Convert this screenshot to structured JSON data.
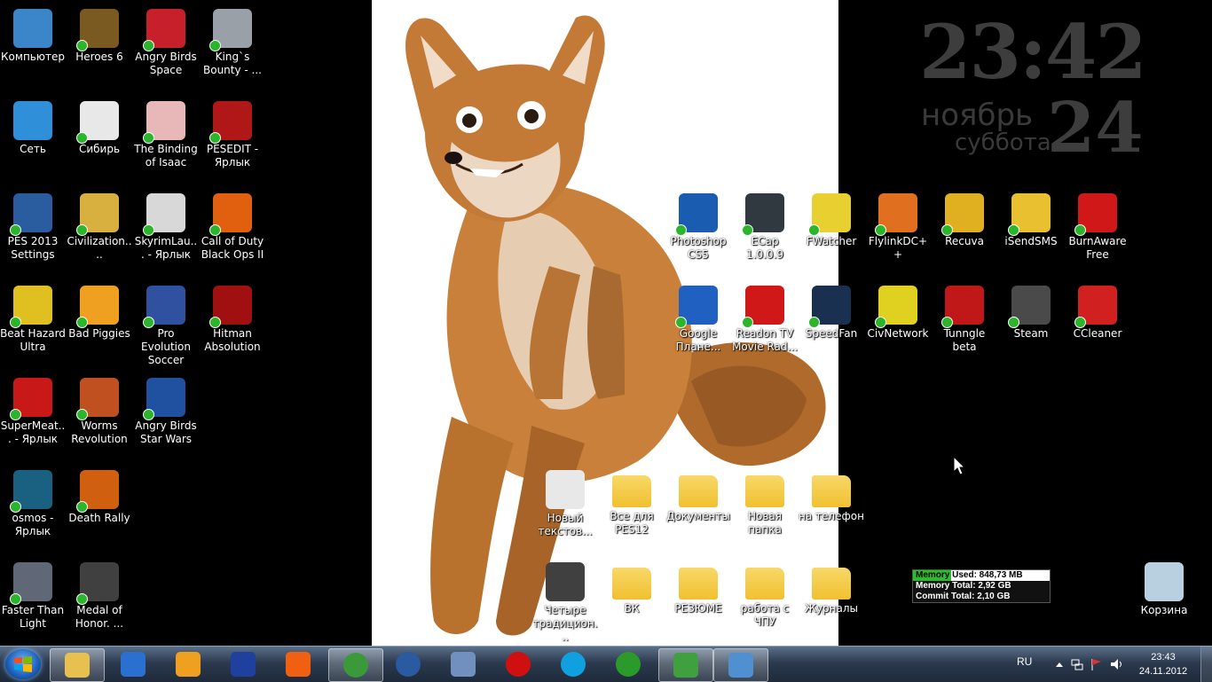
{
  "clock_widget": {
    "time": "23:42",
    "month": "ноябрь",
    "weekday": "суббота",
    "day": "24"
  },
  "desktop_icons": [
    {
      "label": "Компьютер",
      "icon": "computer-icon",
      "color": "#3a86c8"
    },
    {
      "label": "Heroes 6",
      "icon": "griffin-icon",
      "color": "#7a5a20"
    },
    {
      "label": "Angry Birds Space",
      "icon": "angry-bird-icon",
      "color": "#c8202a"
    },
    {
      "label": "King`s Bounty - ...",
      "icon": "helmet-icon",
      "color": "#9aa0a8"
    },
    {
      "label": "Сеть",
      "icon": "network-icon",
      "color": "#2f8fd8"
    },
    {
      "label": "Сибирь",
      "icon": "silhouette-icon",
      "color": "#e8e8e8"
    },
    {
      "label": "The Binding of Isaac",
      "icon": "isaac-icon",
      "color": "#e8b8b8"
    },
    {
      "label": "PESEDIT - Ярлык",
      "icon": "pe-icon",
      "color": "#b01818"
    },
    {
      "label": "PES 2013 Settings",
      "icon": "pes-settings-icon",
      "color": "#2a5ca0"
    },
    {
      "label": "Civilization....",
      "icon": "civilization-icon",
      "color": "#d8b040"
    },
    {
      "label": "SkyrimLau... - Ярлык",
      "icon": "skyrim-icon",
      "color": "#d8d8d8"
    },
    {
      "label": "Call of Duty Black Ops II",
      "icon": "black-ops-icon",
      "color": "#e06010"
    },
    {
      "label": "Beat Hazard Ultra",
      "icon": "hazard-icon",
      "color": "#e0c020"
    },
    {
      "label": "Bad Piggies",
      "icon": "piggy-icon",
      "color": "#f0a020"
    },
    {
      "label": "Pro Evolution Soccer",
      "icon": "pes-icon",
      "color": "#3050a0"
    },
    {
      "label": "Hitman Absolution",
      "icon": "hitman-icon",
      "color": "#a01010"
    },
    {
      "label": "SuperMeat... - Ярлык",
      "icon": "meatboy-icon",
      "color": "#c81818"
    },
    {
      "label": "Worms Revolution",
      "icon": "worms-icon",
      "color": "#c05020"
    },
    {
      "label": "Angry Birds Star Wars",
      "icon": "angry-bird-starwars-icon",
      "color": "#2050a0"
    },
    {
      "label": "osmos - Ярлык",
      "icon": "osmos-icon",
      "color": "#1a6080"
    },
    {
      "label": "Death Rally",
      "icon": "death-rally-icon",
      "color": "#d06010"
    },
    {
      "label": "Faster Than Light",
      "icon": "ftl-icon",
      "color": "#606878"
    },
    {
      "label": "Medal of Honor. ...",
      "icon": "medal-of-honor-icon",
      "color": "#404040"
    },
    {
      "label": "Photoshop CS5",
      "icon": "photoshop-icon",
      "color": "#1a5cb0"
    },
    {
      "label": "ECap 1.0.0.9",
      "icon": "camera-icon",
      "color": "#303840"
    },
    {
      "label": "FWatcher",
      "icon": "fwatcher-icon",
      "color": "#e8d030"
    },
    {
      "label": "FlylinkDC++",
      "icon": "flylink-icon",
      "color": "#e07020"
    },
    {
      "label": "Recuva",
      "icon": "recuva-icon",
      "color": "#e0b020"
    },
    {
      "label": "iSendSMS",
      "icon": "isendsms-icon",
      "color": "#e8c030"
    },
    {
      "label": "BurnAware Free",
      "icon": "burnaware-icon",
      "color": "#d01818"
    },
    {
      "label": "Google Плане...",
      "icon": "google-earth-icon",
      "color": "#2060c0"
    },
    {
      "label": "Readon TV Movie Rad...",
      "icon": "readon-tv-icon",
      "color": "#d01818"
    },
    {
      "label": "SpeedFan",
      "icon": "speedfan-icon",
      "color": "#1a3050"
    },
    {
      "label": "CivNetwork",
      "icon": "civnetwork-icon",
      "color": "#e0d020"
    },
    {
      "label": "Tunngle beta",
      "icon": "tunngle-icon",
      "color": "#c01818"
    },
    {
      "label": "Steam",
      "icon": "steam-icon",
      "color": "#4a4a4a"
    },
    {
      "label": "CCleaner",
      "icon": "ccleaner-icon",
      "color": "#d02020"
    },
    {
      "label": "Новый текстов...",
      "icon": "text-document-icon",
      "color": "#e8e8e8"
    },
    {
      "label": "Все для PES12",
      "icon": "folder-icon",
      "color": "#f0c030"
    },
    {
      "label": "Документы",
      "icon": "folder-icon",
      "color": "#f0c030"
    },
    {
      "label": "Новая папка",
      "icon": "folder-icon",
      "color": "#f0c030"
    },
    {
      "label": "на телефон",
      "icon": "folder-icon",
      "color": "#f0c030"
    },
    {
      "label": "Четыре традицион...",
      "icon": "video-file-icon",
      "color": "#404040"
    },
    {
      "label": "ВК",
      "icon": "folder-icon",
      "color": "#f0c030"
    },
    {
      "label": "РЕЗЮМЕ",
      "icon": "folder-icon",
      "color": "#f0c030"
    },
    {
      "label": "работа с ЧПУ",
      "icon": "folder-icon",
      "color": "#f0c030"
    },
    {
      "label": "Журналы",
      "icon": "folder-icon",
      "color": "#f0c030"
    },
    {
      "label": "Корзина",
      "icon": "recycle-bin-icon",
      "color": "#b8d0e0"
    }
  ],
  "memory_gadget": {
    "used": "Memory Used: 848,73 MB",
    "total": "Memory Total: 2,92 GB",
    "commit": "Commit Total: 2,10 GB",
    "used_fraction": 0.28
  },
  "taskbar": {
    "pinned": [
      {
        "icon": "explorer-icon",
        "color": "#e8c050",
        "active": true
      },
      {
        "icon": "thunder-icon",
        "color": "#2a70d0",
        "active": false
      },
      {
        "icon": "aimp-icon",
        "color": "#f0a020",
        "active": false
      },
      {
        "icon": "save-floppy-icon",
        "color": "#2040a0",
        "active": false
      },
      {
        "icon": "kinopoisk-icon",
        "color": "#f06010",
        "active": false
      },
      {
        "icon": "chrome-icon",
        "color": "#3a9a3a",
        "active": true
      },
      {
        "icon": "kmplayer-icon",
        "color": "#2a5aa0",
        "active": false
      },
      {
        "icon": "paint-icon",
        "color": "#7090c0",
        "active": false
      },
      {
        "icon": "opera-icon",
        "color": "#d01010",
        "active": false
      },
      {
        "icon": "skype-icon",
        "color": "#10a0e0",
        "active": false
      },
      {
        "icon": "utorrent-icon",
        "color": "#2a9a2a",
        "active": false
      },
      {
        "icon": "network-monitor-icon",
        "color": "#40a040",
        "active": true
      },
      {
        "icon": "image-viewer-icon",
        "color": "#5090d0",
        "active": true
      }
    ],
    "language": "RU",
    "time": "23:43",
    "date": "24.11.2012"
  }
}
